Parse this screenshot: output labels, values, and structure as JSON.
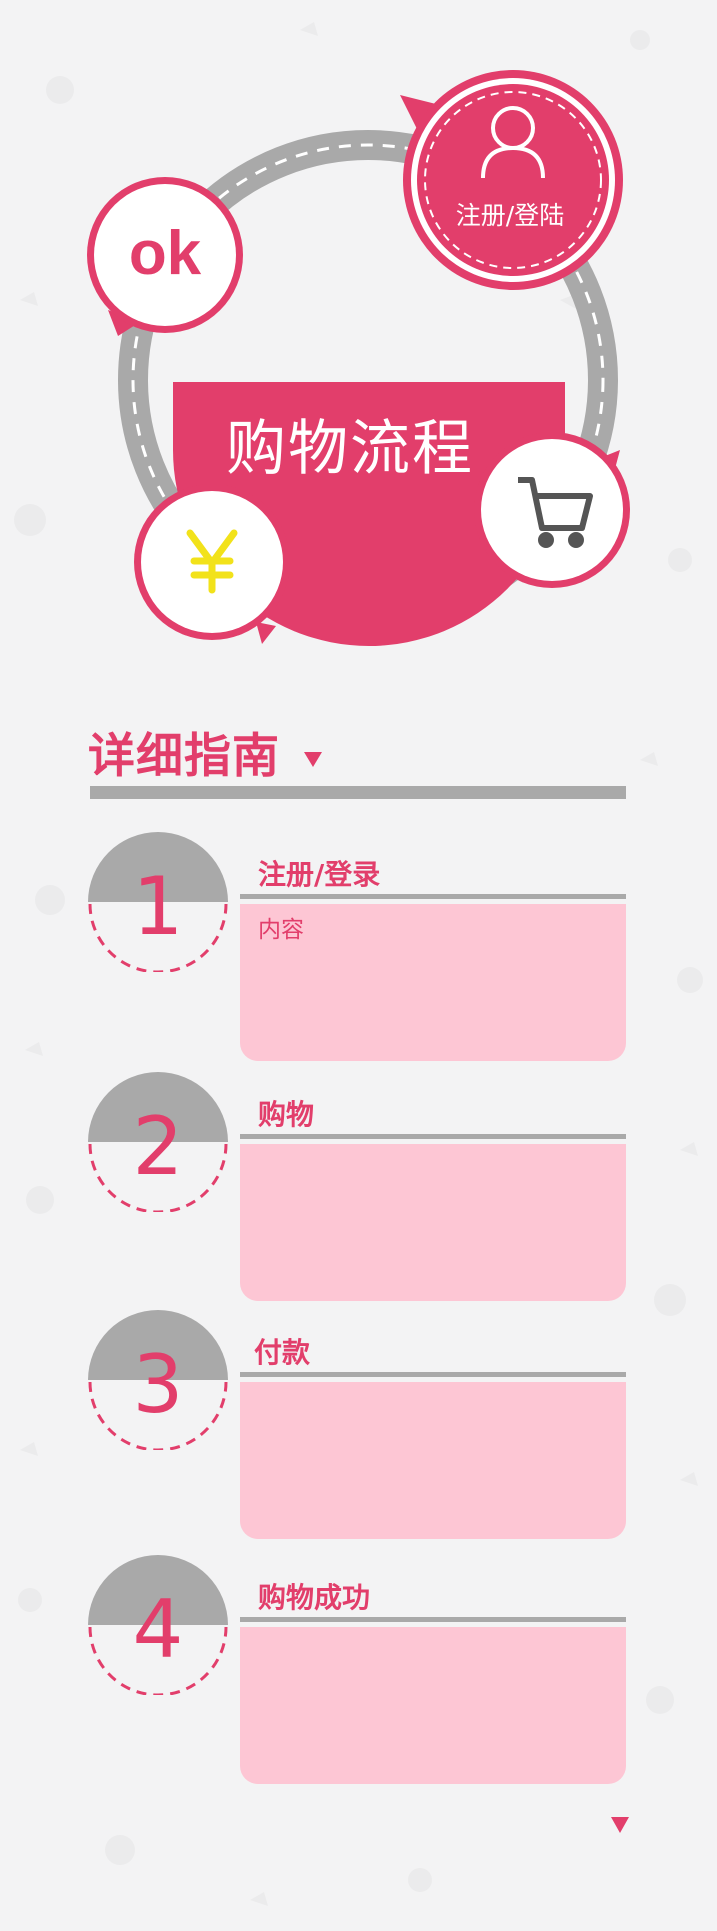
{
  "colors": {
    "accent": "#e23e6b",
    "gray": "#a9a9a9",
    "panel": "#fdc6d4",
    "yen": "#f2e21a",
    "background": "#f3f3f4"
  },
  "hero": {
    "title": "购物流程",
    "login_label": "注册/登陆",
    "icons": [
      "user-icon",
      "ok-icon",
      "yen-icon",
      "cart-icon"
    ],
    "ok_text": "ok",
    "yen_symbol": "¥"
  },
  "guide": {
    "title": "详细指南"
  },
  "steps": [
    {
      "number": "1",
      "title": "注册/登录",
      "content": "内容"
    },
    {
      "number": "2",
      "title": "购物",
      "content": ""
    },
    {
      "number": "3",
      "title": "付款",
      "content": ""
    },
    {
      "number": "4",
      "title": "购物成功",
      "content": ""
    }
  ]
}
